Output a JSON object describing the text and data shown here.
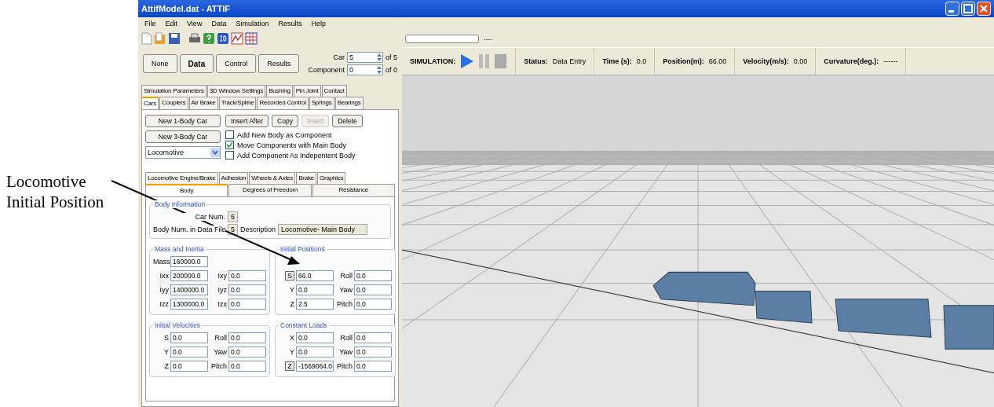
{
  "annotation": {
    "lines": [
      "Locomotive",
      "Initial Position"
    ]
  },
  "window": {
    "title": "AttifModel.dat - ATTIF"
  },
  "menu": [
    "File",
    "Edit",
    "View",
    "Data",
    "Simulation",
    "Results",
    "Help"
  ],
  "mode_buttons": [
    {
      "label": "None",
      "selected": false
    },
    {
      "label": "Data",
      "selected": true
    },
    {
      "label": "Control",
      "selected": false
    },
    {
      "label": "Results",
      "selected": false
    }
  ],
  "spinners": [
    {
      "label": "Car",
      "value": "5",
      "of": "of 5"
    },
    {
      "label": "Component",
      "value": "0",
      "of": "of 0"
    }
  ],
  "tabs_row_1": [
    {
      "label": "Simulation Parameters",
      "selected": false
    },
    {
      "label": "3D Window Settings",
      "selected": false
    },
    {
      "label": "Bushing",
      "selected": false
    },
    {
      "label": "Pin Joint",
      "selected": false
    },
    {
      "label": "Contact",
      "selected": false
    }
  ],
  "tabs_row_2": [
    {
      "label": "Cars",
      "selected": true
    },
    {
      "label": "Couplers",
      "selected": false
    },
    {
      "label": "Air Brake",
      "selected": false
    },
    {
      "label": "Track/Spline",
      "selected": false
    },
    {
      "label": "Recorded Control",
      "selected": false
    },
    {
      "label": "Springs",
      "selected": false
    },
    {
      "label": "Bearings",
      "selected": false
    }
  ],
  "new_car_buttons": [
    "New 1-Body Car",
    "New 3-Body Car"
  ],
  "car_type_dropdown": {
    "value": "Locomotive"
  },
  "action_buttons": [
    {
      "label": "Insert After",
      "disabled": false
    },
    {
      "label": "Copy",
      "disabled": false
    },
    {
      "label": "Insert",
      "disabled": true
    },
    {
      "label": "Delete",
      "disabled": false
    }
  ],
  "checkboxes": [
    {
      "label": "Add New Body as Component",
      "checked": false
    },
    {
      "label": "Move Components with Main Body",
      "checked": true
    },
    {
      "label": "Add Component As Indepentent Body",
      "checked": false
    }
  ],
  "subtabs_row_1": [
    {
      "label": "Locomotive Engine/Brake",
      "selected": false
    },
    {
      "label": "Adhesion",
      "selected": false
    },
    {
      "label": "Wheels & Axles",
      "selected": false
    },
    {
      "label": "Brake",
      "selected": false
    },
    {
      "label": "Graphics",
      "selected": false
    }
  ],
  "subtabs_row_2": [
    {
      "label": "Body",
      "selected": true
    },
    {
      "label": "Degrees of Freedom",
      "selected": false
    },
    {
      "label": "Resistance",
      "selected": false
    }
  ],
  "body_information": {
    "title": "Body Information",
    "car_num_label": "Car Num.",
    "car_num": "5",
    "body_num_label": "Body Num. in Data File",
    "body_num": "5",
    "description_label": "Description",
    "description": "Locomotive- Main Body"
  },
  "groups": [
    {
      "title": "Initial Velocities",
      "rows": [
        [
          {
            "label": "S",
            "value": "0.0",
            "kind": "text"
          },
          {
            "label": "Roll",
            "value": "0.0",
            "kind": "text"
          }
        ],
        [
          {
            "label": "Y",
            "value": "0.0",
            "kind": "text"
          },
          {
            "label": "Yaw",
            "value": "0.0",
            "kind": "text"
          }
        ],
        [
          {
            "label": "Z",
            "value": "0.0",
            "kind": "text"
          },
          {
            "label": "Pitch",
            "value": "0.0",
            "kind": "text"
          }
        ]
      ]
    },
    {
      "title": "Constant Loads",
      "rows": [
        [
          {
            "label": "X",
            "value": "0.0",
            "kind": "text"
          },
          {
            "label": "Roll",
            "value": "0.0",
            "kind": "text"
          }
        ],
        [
          {
            "label": "Y",
            "value": "0.0",
            "kind": "text"
          },
          {
            "label": "Yaw",
            "value": "0.0",
            "kind": "text"
          }
        ],
        [
          {
            "label": "Z",
            "value": "-1569064.0",
            "kind": "button"
          },
          {
            "label": "Pitch",
            "value": "0.0",
            "kind": "text"
          }
        ]
      ]
    }
  ],
  "top_groups": [
    {
      "title": "Mass and Inertia",
      "rows": [
        [
          {
            "label": "Mass",
            "value": "160000.0",
            "kind": "text"
          }
        ],
        [
          {
            "label": "Ixx",
            "value": "200000.0",
            "kind": "text"
          },
          {
            "label": "Ixy",
            "value": "0.0",
            "kind": "text"
          }
        ],
        [
          {
            "label": "Iyy",
            "value": "1400000.0",
            "kind": "text"
          },
          {
            "label": "Iyz",
            "value": "0.0",
            "kind": "text"
          }
        ],
        [
          {
            "label": "Izz",
            "value": "1300000.0",
            "kind": "text"
          },
          {
            "label": "Izx",
            "value": "0.0",
            "kind": "text"
          }
        ]
      ]
    },
    {
      "title": "Initial Positions",
      "rows": [
        [
          {
            "label": "S",
            "value": "66.0",
            "kind": "button"
          },
          {
            "label": "Roll",
            "value": "0.0",
            "kind": "text"
          }
        ],
        [
          {
            "label": "Y",
            "value": "0.0",
            "kind": "text"
          },
          {
            "label": "Yaw",
            "value": "0.0",
            "kind": "text"
          }
        ],
        [
          {
            "label": "Z",
            "value": "2.5",
            "kind": "text"
          },
          {
            "label": "Pitch",
            "value": "0.0",
            "kind": "text"
          }
        ]
      ]
    }
  ],
  "progress_text": "----",
  "simulation": {
    "label": "SIMULATION:",
    "status": [
      {
        "label": "Status:",
        "value": "Data Entry"
      },
      {
        "label": "Time (s):",
        "value": "0.0"
      },
      {
        "label": "Position(m):",
        "value": "66.00"
      },
      {
        "label": "Velocity(m/s):",
        "value": "0.00"
      },
      {
        "label": "Curvature(deg.):",
        "value": "------"
      }
    ]
  }
}
